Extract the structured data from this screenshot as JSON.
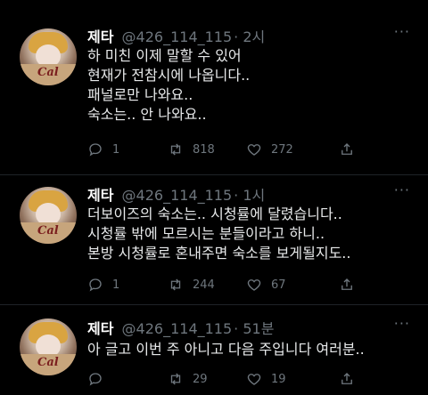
{
  "tweets": [
    {
      "name": "제타",
      "handle": "@426_114_115",
      "time": "· 2시",
      "lines": [
        "하 미친 이제 말할 수 있어",
        "현재가 전참시에 나옵니다..",
        "패널로만 나와요..",
        "숙소는.. 안 나와요.."
      ],
      "replies": "1",
      "retweets": "818",
      "likes": "272",
      "more": "···"
    },
    {
      "name": "제타",
      "handle": "@426_114_115",
      "time": "· 1시",
      "lines": [
        "더보이즈의 숙소는.. 시청률에 달렸습니다..",
        "시청률 밖에 모르시는 분들이라고 하니..",
        "본방 시청률로 혼내주면 숙소를 보게될지도.."
      ],
      "replies": "1",
      "retweets": "244",
      "likes": "67",
      "more": "···"
    },
    {
      "name": "제타",
      "handle": "@426_114_115",
      "time": "· 51분",
      "lines": [
        "아 글고 이번 주 아니고 다음 주입니다 여러분.."
      ],
      "replies": "",
      "retweets": "29",
      "likes": "19",
      "more": "···"
    }
  ],
  "icons": {
    "reply": "reply-icon",
    "retweet": "retweet-icon",
    "like": "heart-icon",
    "share": "share-icon",
    "more": "more-icon"
  },
  "colors": {
    "background": "#000000",
    "text": "#e7e9ea",
    "muted": "#6e767d"
  }
}
